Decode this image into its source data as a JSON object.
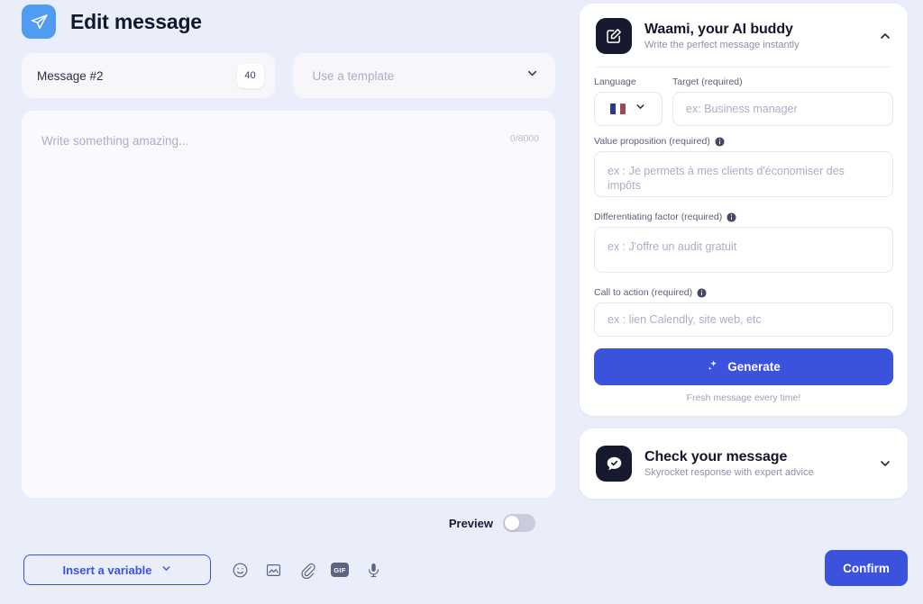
{
  "header": {
    "icon": "send-plane-icon",
    "title": "Edit message"
  },
  "message_name": {
    "value": "Message #2",
    "char_badge": "40"
  },
  "template": {
    "placeholder": "Use a template",
    "chevron_icon": "chevron-down-icon"
  },
  "editor": {
    "placeholder": "Write something amazing...",
    "counter": "0/8000"
  },
  "preview": {
    "label": "Preview",
    "enabled": false
  },
  "bottom_toolbar": {
    "insert_variable_label": "Insert a variable",
    "icons": [
      {
        "name": "emoji-icon"
      },
      {
        "name": "image-icon"
      },
      {
        "name": "attachment-icon"
      },
      {
        "name": "gif-icon",
        "label": "GIF"
      },
      {
        "name": "microphone-icon"
      }
    ],
    "confirm_label": "Confirm"
  },
  "ai_panel": {
    "icon": "edit-square-icon",
    "title": "Waami, your AI buddy",
    "subtitle": "Write the perfect message instantly",
    "chevron_icon": "chevron-up-icon",
    "language": {
      "label": "Language",
      "flag": "fr-flag-icon",
      "chevron_icon": "chevron-down-icon"
    },
    "target": {
      "label": "Target (required)",
      "placeholder": "ex: Business manager"
    },
    "value_proposition": {
      "label": "Value proposition (required)",
      "info_icon": "info-icon",
      "placeholder": "ex : Je permets à mes clients d'économiser des impôts"
    },
    "differentiating_factor": {
      "label": "Differentiating factor (required)",
      "info_icon": "info-icon",
      "placeholder": "ex : J'offre un audit gratuit"
    },
    "call_to_action": {
      "label": "Call to action (required)",
      "info_icon": "info-icon",
      "placeholder": "ex : lien Calendly, site web, etc"
    },
    "generate": {
      "label": "Generate",
      "icon": "sparkle-icon",
      "note": "Fresh message every time!"
    }
  },
  "check_panel": {
    "icon": "chat-check-icon",
    "title": "Check your message",
    "subtitle": "Skyrocket response with expert advice",
    "chevron_icon": "chevron-down-icon"
  },
  "colors": {
    "page_bg": "#eaeefa",
    "accent_blue": "#3b52dd",
    "send_icon_bg": "#4f9cf0",
    "card_dark": "#171a2e"
  }
}
